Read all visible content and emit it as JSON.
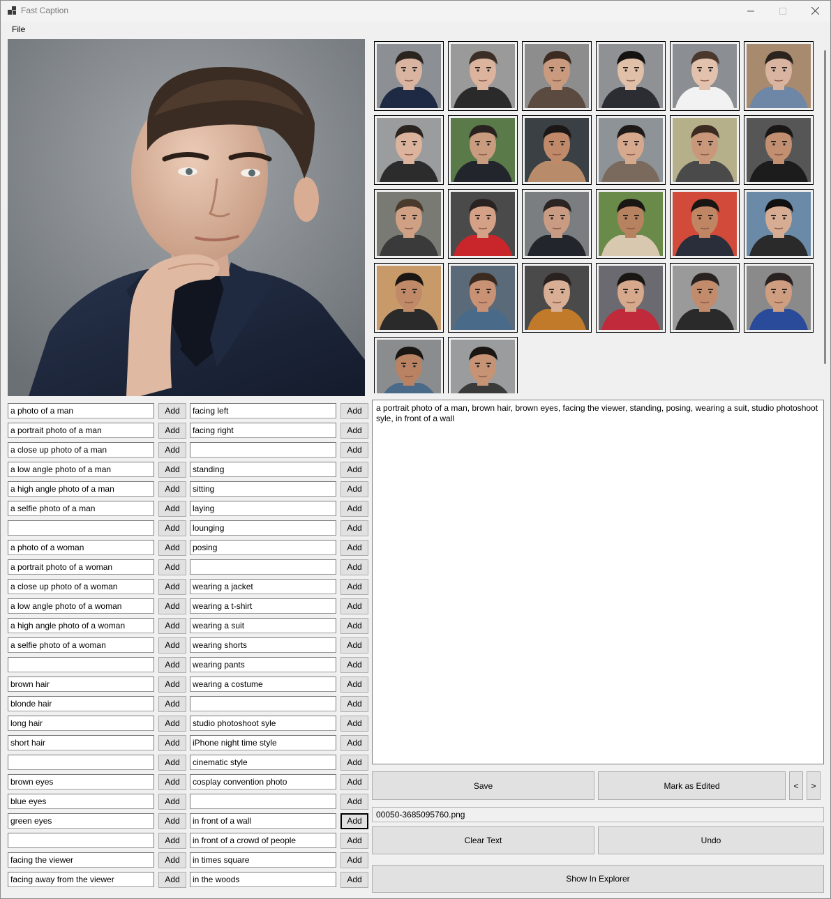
{
  "window": {
    "title": "Fast Caption",
    "controls": {
      "minimize": "minimize-icon",
      "maximize": "maximize-icon",
      "close": "close-icon"
    }
  },
  "menu": {
    "items": [
      "File"
    ]
  },
  "preview": {
    "image": "man-in-navy-suit-portrait"
  },
  "thumbnails": [
    {
      "skin": "#d9b4a0",
      "hair": "#2b231e",
      "shirt": "#1e2a44",
      "bg": "#8c9094"
    },
    {
      "skin": "#dcb39c",
      "hair": "#3a2e26",
      "shirt": "#2a2a2a",
      "bg": "#9a9a9a"
    },
    {
      "skin": "#c99a7e",
      "hair": "#3b2b21",
      "shirt": "#5a4a40",
      "bg": "#8d8d8d"
    },
    {
      "skin": "#e0c0a8",
      "hair": "#151312",
      "shirt": "#2b2d33",
      "bg": "#8f9194"
    },
    {
      "skin": "#e3c2ad",
      "hair": "#4a382c",
      "shirt": "#f2f2f2",
      "bg": "#8b8e92"
    },
    {
      "skin": "#d9b4a0",
      "hair": "#2b231e",
      "shirt": "#6f87a6",
      "bg": "#a88a6e"
    },
    {
      "skin": "#dcb39c",
      "hair": "#2b231e",
      "shirt": "#2c2c2c",
      "bg": "#9a9c9e"
    },
    {
      "skin": "#c99b7f",
      "hair": "#2a2220",
      "shirt": "#22262c",
      "bg": "#5a7a4a"
    },
    {
      "skin": "#c08a6a",
      "hair": "#1b1716",
      "shirt": "#b88b6a",
      "bg": "#3a4044"
    },
    {
      "skin": "#d6a98e",
      "hair": "#1e1a18",
      "shirt": "#7a6a5e",
      "bg": "#8d9396"
    },
    {
      "skin": "#c9977a",
      "hair": "#3b2b21",
      "shirt": "#4a4a4a",
      "bg": "#b5b08a"
    },
    {
      "skin": "#c38f71",
      "hair": "#1a1716",
      "shirt": "#1c1c1c",
      "bg": "#565656"
    },
    {
      "skin": "#cfa084",
      "hair": "#4a3a2c",
      "shirt": "#3a3a3a",
      "bg": "#7a7a74"
    },
    {
      "skin": "#d4a187",
      "hair": "#2a2220",
      "shirt": "#c8262a",
      "bg": "#4a4a4a"
    },
    {
      "skin": "#c99b82",
      "hair": "#2a2422",
      "shirt": "#22262c",
      "bg": "#7a7e80"
    },
    {
      "skin": "#b7825f",
      "hair": "#1a1614",
      "shirt": "#d8c8b0",
      "bg": "#6a8a4a"
    },
    {
      "skin": "#c08664",
      "hair": "#1a1614",
      "shirt": "#2a2e3a",
      "bg": "#d24a3a"
    },
    {
      "skin": "#d6ac92",
      "hair": "#111111",
      "shirt": "#2a2a2a",
      "bg": "#6a8aa8"
    },
    {
      "skin": "#c08a68",
      "hair": "#1a1614",
      "shirt": "#2a2a2a",
      "bg": "#c89a6a"
    },
    {
      "skin": "#c99274",
      "hair": "#3a2a20",
      "shirt": "#4a6a8a",
      "bg": "#5a6a78"
    },
    {
      "skin": "#d8ae94",
      "hair": "#2a2220",
      "shirt": "#c07a2a",
      "bg": "#4a4a4a"
    },
    {
      "skin": "#d6a88c",
      "hair": "#1a1614",
      "shirt": "#c02a3a",
      "bg": "#6a6a70"
    },
    {
      "skin": "#c28c6c",
      "hair": "#2a2220",
      "shirt": "#2a2a2a",
      "bg": "#9a9a9a"
    },
    {
      "skin": "#cf9e80",
      "hair": "#2a2220",
      "shirt": "#2a4a9a",
      "bg": "#8a8a8a"
    },
    {
      "skin": "#b98262",
      "hair": "#1a1614",
      "shirt": "#4a6a8a",
      "bg": "#8a8c8e"
    },
    {
      "skin": "#c69474",
      "hair": "#1a1614",
      "shirt": "#3a3a3a",
      "bg": "#9a9c9e"
    }
  ],
  "tags": {
    "left": [
      "a photo of a man",
      "a portrait photo of a man",
      "a close up photo of a man",
      "a low angle photo of a man",
      "a high angle photo of a man",
      "a selfie photo of a man",
      "",
      "a photo of a woman",
      "a portrait photo of a woman",
      "a close up photo of a woman",
      "a low angle photo of a woman",
      "a high angle photo of a woman",
      "a selfie photo of a woman",
      "",
      "brown hair",
      "blonde hair",
      "long hair",
      "short hair",
      "",
      "brown eyes",
      "blue eyes",
      "green eyes",
      "",
      "facing the viewer",
      "facing away from the viewer"
    ],
    "right": [
      "facing left",
      "facing right",
      "",
      "standing",
      "sitting",
      "laying",
      "lounging",
      "posing",
      "",
      "wearing a jacket",
      "wearing a t-shirt",
      "wearing a suit",
      "wearing shorts",
      "wearing pants",
      "wearing a costume",
      "",
      "studio photoshoot syle",
      "iPhone night time style",
      "cinematic style",
      "cosplay convention photo",
      "",
      "in front of a wall",
      "in front of a crowd of people",
      "in times square",
      "in the woods"
    ],
    "add_label": "Add"
  },
  "caption": {
    "text": "a portrait photo of a man, brown hair, brown eyes, facing the viewer, standing, posing, wearing a suit, studio photoshoot syle, in front of a wall"
  },
  "buttons": {
    "save": "Save",
    "mark_edited": "Mark as Edited",
    "prev": "<",
    "next": ">",
    "clear_text": "Clear Text",
    "undo": "Undo",
    "show_in_explorer": "Show In Explorer"
  },
  "filename": "00050-3685095760.png"
}
